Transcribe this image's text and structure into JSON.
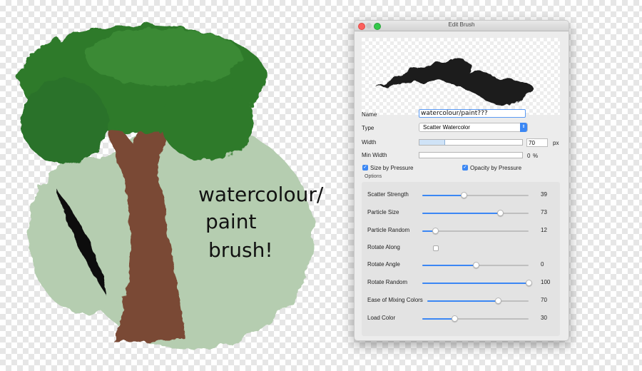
{
  "handwriting": {
    "line1": "watercolour/",
    "line2": "paint",
    "line3": "brush!"
  },
  "window": {
    "title": "Edit Brush"
  },
  "labels": {
    "name": "Name",
    "type": "Type",
    "width": "Width",
    "min_width": "Min Width",
    "size_by_pressure": "Size by Pressure",
    "opacity_by_pressure": "Opacity by Pressure",
    "options": "Options"
  },
  "fields": {
    "name_value": "watercolour/paint???",
    "type_value": "Scatter Watercolor",
    "width_value": "70",
    "width_unit": "px",
    "width_fraction": 0.24,
    "min_width_value": "0",
    "min_width_unit": "%",
    "min_width_fraction": 0.0,
    "size_by_pressure": true,
    "opacity_by_pressure": true
  },
  "options": [
    {
      "label": "Scatter Strength",
      "value": "39",
      "fraction": 0.39,
      "kind": "slider"
    },
    {
      "label": "Particle Size",
      "value": "73",
      "fraction": 0.73,
      "kind": "slider"
    },
    {
      "label": "Particle Random",
      "value": "12",
      "fraction": 0.12,
      "kind": "slider"
    },
    {
      "label": "Rotate Along",
      "value": "",
      "checked": false,
      "kind": "checkbox"
    },
    {
      "label": "Rotate Angle",
      "value": "0",
      "fraction": 0.5,
      "kind": "slider"
    },
    {
      "label": "Rotate Random",
      "value": "100",
      "fraction": 1.0,
      "kind": "slider"
    },
    {
      "label": "Ease of Mixing Colors",
      "value": "70",
      "fraction": 0.7,
      "kind": "slider"
    },
    {
      "label": "Load Color",
      "value": "30",
      "fraction": 0.3,
      "kind": "slider"
    }
  ],
  "colors": {
    "accent": "#3b87f4",
    "canopy": "#2f7a2c",
    "trunk": "#7a4a34",
    "backdrop": "#b5cdb0"
  }
}
